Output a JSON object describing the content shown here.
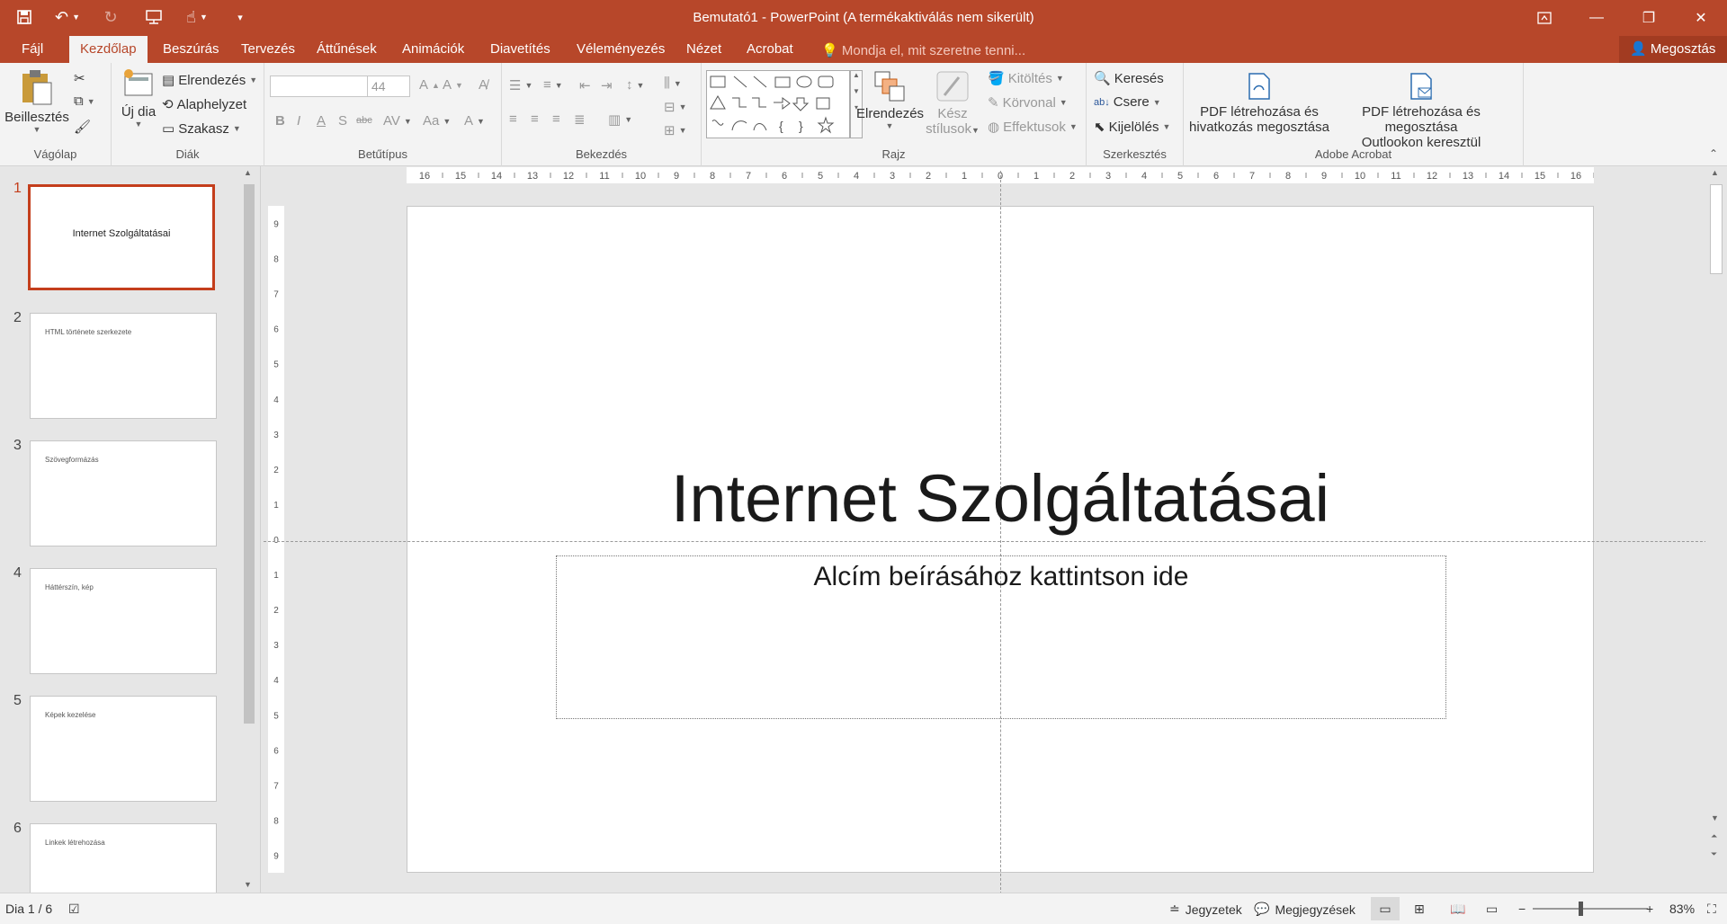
{
  "app": {
    "title": "Bemutató1 - PowerPoint (A termékaktiválás nem sikerült)",
    "accent": "#b7472a"
  },
  "qat": {
    "save_icon": "save-icon",
    "undo_icon": "undo-icon",
    "redo_icon": "redo-icon",
    "present_icon": "present-icon",
    "touch_icon": "touch-mode-icon"
  },
  "tabs": [
    {
      "label": "Fájl"
    },
    {
      "label": "Kezdőlap"
    },
    {
      "label": "Beszúrás"
    },
    {
      "label": "Tervezés"
    },
    {
      "label": "Áttűnések"
    },
    {
      "label": "Animációk"
    },
    {
      "label": "Diavetítés"
    },
    {
      "label": "Véleményezés"
    },
    {
      "label": "Nézet"
    },
    {
      "label": "Acrobat"
    }
  ],
  "tell_me": "Mondja el, mit szeretne tenni...",
  "share": "Megosztás",
  "ribbon": {
    "clipboard": {
      "label": "Vágólap",
      "paste": "Beillesztés"
    },
    "slides": {
      "label": "Diák",
      "new_slide": "Új dia",
      "layout": "Elrendezés",
      "reset": "Alaphelyzet",
      "section": "Szakasz"
    },
    "font": {
      "label": "Betűtípus",
      "size": "44"
    },
    "paragraph": {
      "label": "Bekezdés"
    },
    "drawing": {
      "label": "Rajz",
      "arrange": "Elrendezés",
      "quick_styles_1": "Kész",
      "quick_styles_2": "stílusok",
      "fill": "Kitöltés",
      "outline": "Körvonal",
      "effects": "Effektusok"
    },
    "editing": {
      "label": "Szerkesztés",
      "find": "Keresés",
      "replace": "Csere",
      "select": "Kijelölés"
    },
    "acrobat": {
      "label": "Adobe Acrobat",
      "pdf_share_1": "PDF létrehozása és",
      "pdf_share_2": "hivatkozás megosztása",
      "pdf_outlook_1": "PDF létrehozása és megosztása",
      "pdf_outlook_2": "Outlookon keresztül"
    }
  },
  "thumbnails": [
    {
      "num": "1",
      "title": "Internet Szolgáltatásai"
    },
    {
      "num": "2",
      "title": "HTML története szerkezete"
    },
    {
      "num": "3",
      "title": "Szövegformázás"
    },
    {
      "num": "4",
      "title": "Háttérszín, kép"
    },
    {
      "num": "5",
      "title": "Képek kezelése"
    },
    {
      "num": "6",
      "title": "Linkek létrehozása"
    }
  ],
  "ruler": {
    "h_ticks": [
      "16",
      "15",
      "14",
      "13",
      "12",
      "11",
      "10",
      "9",
      "8",
      "7",
      "6",
      "5",
      "4",
      "3",
      "2",
      "1",
      "0",
      "1",
      "2",
      "3",
      "4",
      "5",
      "6",
      "7",
      "8",
      "9",
      "10",
      "11",
      "12",
      "13",
      "14",
      "15",
      "16"
    ],
    "v_ticks": [
      "9",
      "8",
      "7",
      "6",
      "5",
      "4",
      "3",
      "2",
      "1",
      "0",
      "1",
      "2",
      "3",
      "4",
      "5",
      "6",
      "7",
      "8",
      "9"
    ]
  },
  "slide": {
    "title": "Internet Szolgáltatásai",
    "subtitle_placeholder": "Alcím beírásához kattintson ide"
  },
  "status": {
    "slide_counter": "Dia 1 / 6",
    "notes": "Jegyzetek",
    "comments": "Megjegyzések",
    "zoom": "83%"
  }
}
